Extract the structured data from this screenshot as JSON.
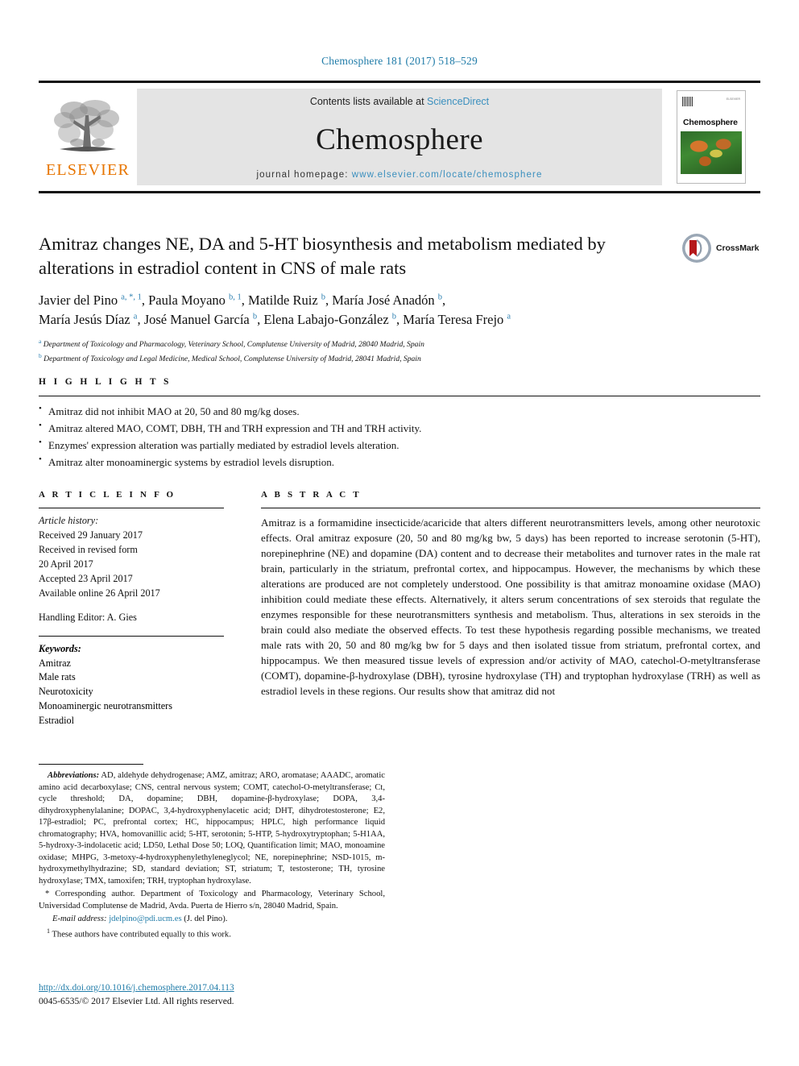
{
  "running_head": "Chemosphere 181 (2017) 518–529",
  "masthead": {
    "publisher_name": "ELSEVIER",
    "contents_prefix": "Contents lists available at ",
    "contents_link": "ScienceDirect",
    "journal_wordmark": "Chemosphere",
    "homepage_label": "journal homepage: ",
    "homepage_url": "www.elsevier.com/locate/chemosphere",
    "cover_title": "Chemosphere",
    "cover_publisher": "ELSEVIER"
  },
  "crossmark": {
    "label": "CrossMark"
  },
  "article": {
    "title": "Amitraz changes NE, DA and 5-HT biosynthesis and metabolism mediated by alterations in estradiol content in CNS of male rats",
    "authors_line1": "Javier del Pino ",
    "authors": [
      {
        "name": "Javier del Pino",
        "marks": "a, *, 1"
      },
      {
        "name": "Paula Moyano",
        "marks": "b, 1"
      },
      {
        "name": "Matilde Ruiz",
        "marks": "b"
      },
      {
        "name": "María José Anadón",
        "marks": "b"
      },
      {
        "name": "María Jesús Díaz",
        "marks": "a"
      },
      {
        "name": "José Manuel García",
        "marks": "b"
      },
      {
        "name": "Elena Labajo-González",
        "marks": "b"
      },
      {
        "name": "María Teresa Frejo",
        "marks": "a"
      }
    ],
    "affiliations": [
      {
        "mark": "a",
        "text": "Department of Toxicology and Pharmacology, Veterinary School, Complutense University of Madrid, 28040 Madrid, Spain"
      },
      {
        "mark": "b",
        "text": "Department of Toxicology and Legal Medicine, Medical School, Complutense University of Madrid, 28041 Madrid, Spain"
      }
    ]
  },
  "highlights": {
    "heading": "H I G H L I G H T S",
    "items": [
      "Amitraz did not inhibit MAO at 20, 50 and 80 mg/kg doses.",
      "Amitraz altered MAO, COMT, DBH, TH and TRH expression and TH and TRH activity.",
      "Enzymes' expression alteration was partially mediated by estradiol levels alteration.",
      "Amitraz alter monoaminergic systems by estradiol levels disruption."
    ]
  },
  "article_info": {
    "heading": "A R T I C L E   I N F O",
    "history_label": "Article history:",
    "history": [
      "Received 29 January 2017",
      "Received in revised form",
      "20 April 2017",
      "Accepted 23 April 2017",
      "Available online 26 April 2017"
    ],
    "handling_editor": "Handling Editor: A. Gies",
    "keywords_label": "Keywords:",
    "keywords": [
      "Amitraz",
      "Male rats",
      "Neurotoxicity",
      "Monoaminergic neurotransmitters",
      "Estradiol"
    ]
  },
  "abstract": {
    "heading": "A B S T R A C T",
    "text": "Amitraz is a formamidine insecticide/acaricide that alters different neurotransmitters levels, among other neurotoxic effects. Oral amitraz exposure (20, 50 and 80 mg/kg bw, 5 days) has been reported to increase serotonin (5-HT), norepinephrine (NE) and dopamine (DA) content and to decrease their metabolites and turnover rates in the male rat brain, particularly in the striatum, prefrontal cortex, and hippocampus. However, the mechanisms by which these alterations are produced are not completely understood. One possibility is that amitraz monoamine oxidase (MAO) inhibition could mediate these effects. Alternatively, it alters serum concentrations of sex steroids that regulate the enzymes responsible for these neurotransmitters synthesis and metabolism. Thus, alterations in sex steroids in the brain could also mediate the observed effects. To test these hypothesis regarding possible mechanisms, we treated male rats with 20, 50 and 80 mg/kg bw for 5 days and then isolated tissue from striatum, prefrontal cortex, and hippocampus. We then measured tissue levels of expression and/or activity of MAO, catechol-O-metyltransferase (COMT), dopamine-β-hydroxylase (DBH), tyrosine hydroxylase (TH) and tryptophan hydroxylase (TRH) as well as estradiol levels in these regions. Our results show that amitraz did not"
  },
  "footnotes": {
    "abbreviations_label": "Abbreviations:",
    "abbreviations_text": " AD, aldehyde dehydrogenase; AMZ, amitraz; ARO, aromatase; AAADC, aromatic amino acid decarboxylase; CNS, central nervous system; COMT, catechol-O-metyltransferase; Ct, cycle threshold; DA, dopamine; DBH, dopamine-β-hydroxylase; DOPA, 3,4-dihydroxyphenylalanine; DOPAC, 3,4-hydroxyphenylacetic acid; DHT, dihydrotestosterone; E2, 17β-estradiol; PC, prefrontal cortex; HC, hippocampus; HPLC, high performance liquid chromatography; HVA, homovanillic acid; 5-HT, serotonin; 5-HTP, 5-hydroxytryptophan; 5-H1AA, 5-hydroxy-3-indolacetic acid; LD50, Lethal Dose 50; LOQ, Quantification limit; MAO, monoamine oxidase; MHPG, 3-metoxy-4-hydroxyphenylethyleneglycol; NE, norepinephrine; NSD-1015, m-hydroxymethylhydrazine; SD, standard deviation; ST, striatum; T, testosterone; TH, tyrosine hydroxylase; TMX, tamoxifen; TRH, tryptophan hydroxylase.",
    "corresponding_mark": "*",
    "corresponding_text": " Corresponding author. Department of Toxicology and Pharmacology, Veterinary School, Universidad Complutense de Madrid, Avda. Puerta de Hierro s/n, 28040 Madrid, Spain.",
    "email_label": "E-mail address:",
    "email_address": "jdelpino@pdi.ucm.es",
    "email_suffix": " (J. del Pino).",
    "equal_contrib_mark": "1",
    "equal_contrib_text": " These authors have contributed equally to this work."
  },
  "footer": {
    "doi_url": "http://dx.doi.org/10.1016/j.chemosphere.2017.04.113",
    "copyright": "0045-6535/© 2017 Elsevier Ltd. All rights reserved."
  },
  "colors": {
    "link_blue": "#1f7ba8",
    "elsevier_orange": "#E77500",
    "masthead_gray": "#e4e4e4",
    "sup_blue": "#2b7fb0"
  }
}
